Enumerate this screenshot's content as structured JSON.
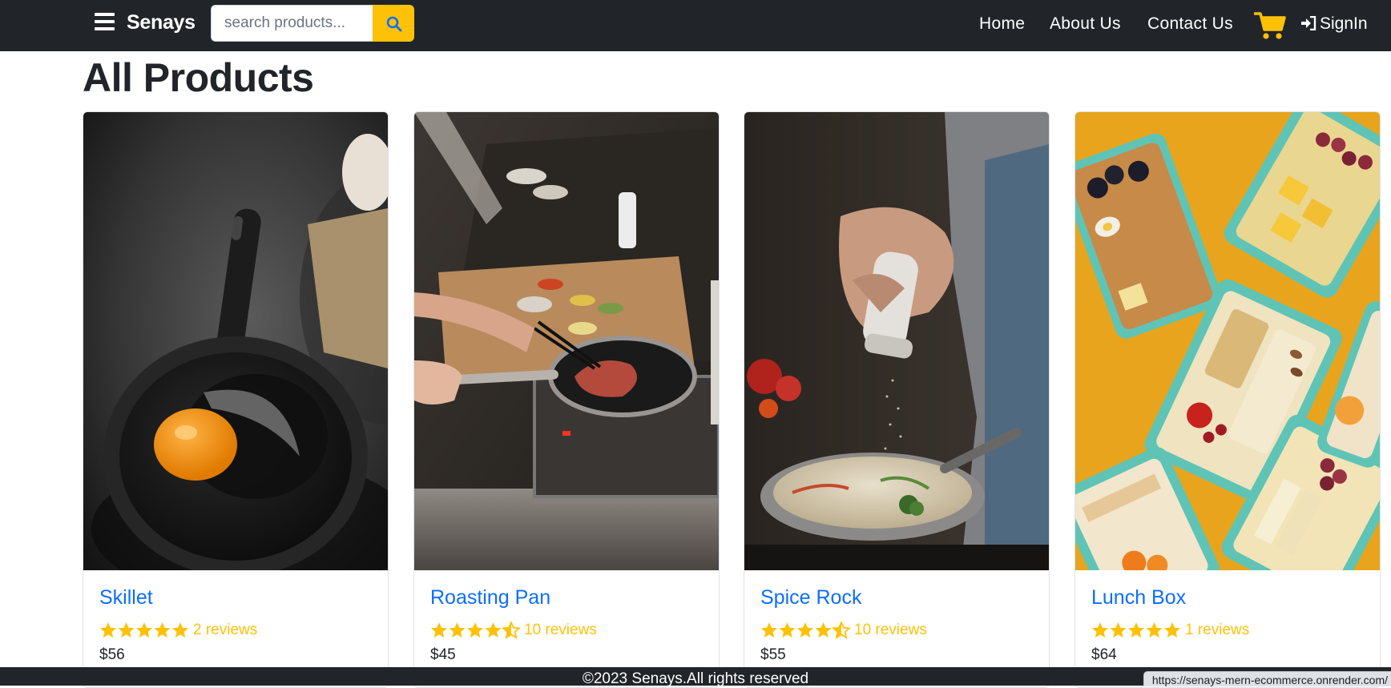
{
  "navbar": {
    "brand": "Senays",
    "search_placeholder": "search products...",
    "links": {
      "home": "Home",
      "about": "About Us",
      "contact": "Contact Us"
    },
    "signin": "SignIn",
    "cart_color": "#ffc107"
  },
  "main": {
    "title": "All Products",
    "products": [
      {
        "name": "Skillet",
        "rating": 5,
        "reviews": "2 reviews",
        "price": "$56"
      },
      {
        "name": "Roasting Pan",
        "rating": 4.5,
        "reviews": "10 reviews",
        "price": "$45"
      },
      {
        "name": "Spice Rock",
        "rating": 4.5,
        "reviews": "10 reviews",
        "price": "$55"
      },
      {
        "name": "Lunch Box",
        "rating": 5,
        "reviews": "1 reviews",
        "price": "$64"
      }
    ]
  },
  "footer": {
    "text": "©2023 Senays.All rights reserved"
  },
  "status_bar": {
    "url": "https://senays-mern-ecommerce.onrender.com/"
  },
  "colors": {
    "navbar_bg": "#212529",
    "accent": "#ffc107",
    "link": "#0d6efd"
  }
}
